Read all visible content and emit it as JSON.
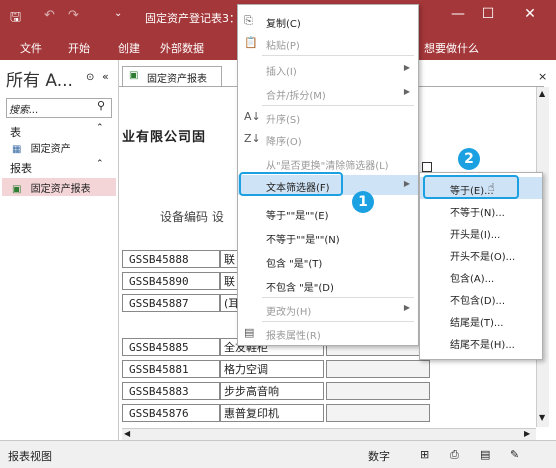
{
  "titlebar": {
    "qa_save": "🖫",
    "qa_undo": "↶",
    "qa_redo": "↷",
    "qa_more": "⌄",
    "title": "固定资产登记表3：",
    "min": "—",
    "max": "☐",
    "close": "✕"
  },
  "ribbon": {
    "tabs": [
      "文件",
      "开始",
      "创建",
      "外部数据"
    ],
    "tell_me": "想要做什么"
  },
  "nav": {
    "header": "所有 A...",
    "search_placeholder": "搜索...",
    "groups": [
      {
        "label": "表",
        "items": [
          "固定资产"
        ]
      },
      {
        "label": "报表",
        "items": [
          "固定资产报表"
        ]
      }
    ]
  },
  "doc": {
    "tab_label": "固定资产报表",
    "company": "业有限公司固",
    "col_header": "设备编码 设",
    "rows": [
      {
        "code": "GSSB45888",
        "name": "联"
      },
      {
        "code": "GSSB45890",
        "name": "联"
      },
      {
        "code": "GSSB45887",
        "name": "(耳"
      },
      {
        "code": "GSSB45885",
        "name": "全友鞋柜"
      },
      {
        "code": "GSSB45881",
        "name": "格力空调"
      },
      {
        "code": "GSSB45883",
        "name": "步步高音响"
      },
      {
        "code": "GSSB45876",
        "name": "惠普复印机"
      }
    ]
  },
  "context_menu": {
    "items": [
      {
        "label": "复制(C)",
        "icon": "copy-icon",
        "disabled": false
      },
      {
        "label": "粘贴(P)",
        "icon": "paste-icon",
        "disabled": true
      },
      {
        "label": "插入(I)",
        "disabled": true,
        "submenu": true
      },
      {
        "label": "合并/拆分(M)",
        "disabled": true,
        "submenu": true
      },
      {
        "label": "升序(S)",
        "icon": "sort-asc-icon",
        "disabled": true
      },
      {
        "label": "降序(O)",
        "icon": "sort-desc-icon",
        "disabled": true
      },
      {
        "label": "从\"是否更换\"清除筛选器(L)",
        "disabled": true
      },
      {
        "label": "文本筛选器(F)",
        "disabled": false,
        "submenu": true,
        "highlighted": true
      },
      {
        "label": "等于\"\"是\"\"(E)",
        "disabled": false
      },
      {
        "label": "不等于\"\"是\"\"(N)",
        "disabled": false
      },
      {
        "label": "包含 \"是\"(T)",
        "disabled": false
      },
      {
        "label": "不包含 \"是\"(D)",
        "disabled": false
      },
      {
        "label": "更改为(H)",
        "disabled": true,
        "submenu": true
      },
      {
        "label": "报表属性(R)",
        "icon": "properties-icon",
        "disabled": true
      }
    ]
  },
  "submenu": {
    "items": [
      "等于(E)...",
      "不等于(N)...",
      "开头是(I)...",
      "开头不是(O)...",
      "包含(A)...",
      "不包含(D)...",
      "结尾是(T)...",
      "结尾不是(H)..."
    ]
  },
  "callouts": {
    "one": "1",
    "two": "2"
  },
  "status": {
    "left": "报表视图",
    "numlock": "数字"
  },
  "colors": {
    "access_red": "#a4373a",
    "highlight_blue": "#1ba1e2",
    "menu_hover": "#cfe3f6"
  }
}
